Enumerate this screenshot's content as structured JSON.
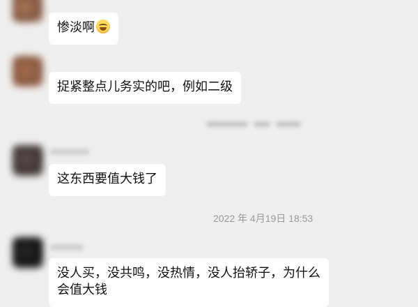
{
  "messages": [
    {
      "text": "惨淡啊",
      "emoji": "grimace-emoji"
    },
    {
      "text": "捉紧整点儿务实的吧，例如二级"
    },
    {
      "text": "这东西要值大钱了"
    },
    {
      "text": "没人买，没共鸣，没热情，没人抬轿子，为什么"
    },
    {
      "text": "会值大钱"
    }
  ],
  "timestamp": "2022 年 4月19日 18:53",
  "colors": {
    "background": "#efefef",
    "bubble": "#ffffff",
    "timestamp": "#9a9a9a"
  }
}
